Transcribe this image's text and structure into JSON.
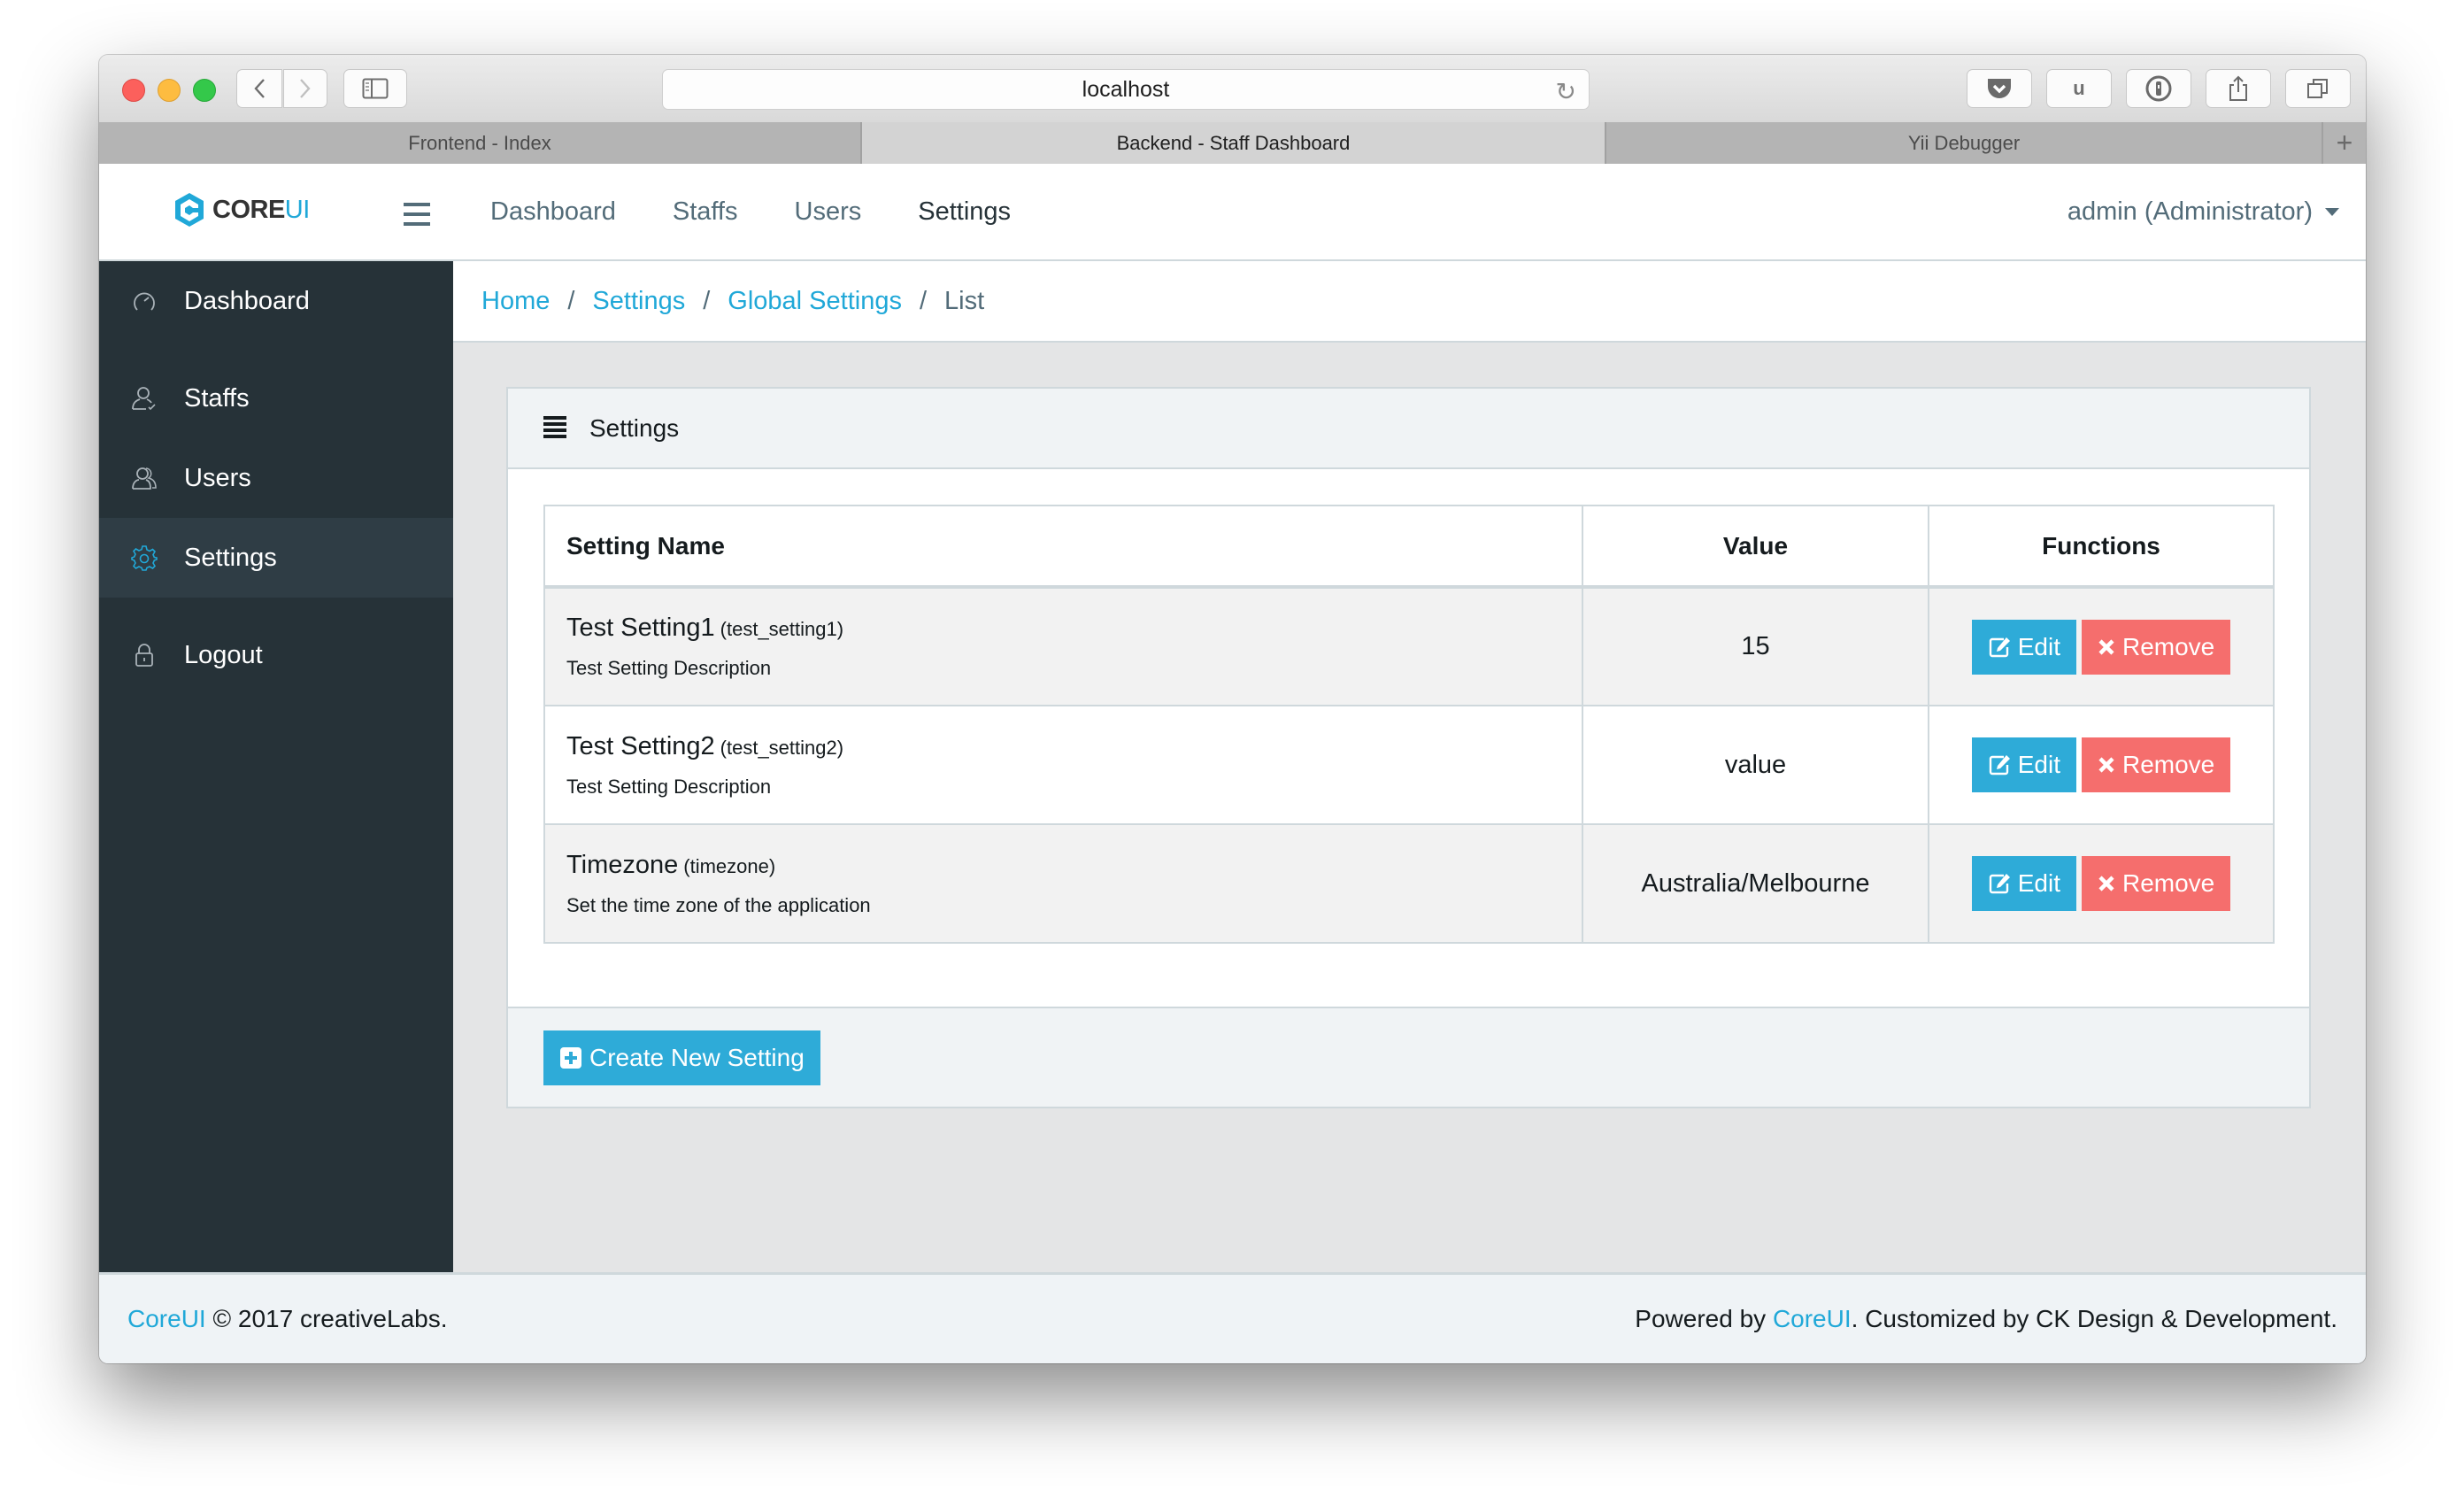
{
  "browser": {
    "address": "localhost",
    "tabs": [
      {
        "label": "Frontend - Index",
        "active": false
      },
      {
        "label": "Backend - Staff Dashboard",
        "active": true
      },
      {
        "label": "Yii Debugger",
        "active": false
      }
    ],
    "toolbar_icons": [
      "pocket-icon",
      "ublock-icon",
      "1password-icon",
      "share-icon",
      "tabs-overview-icon"
    ],
    "ublock_label": "u",
    "new_tab_label": "+"
  },
  "header": {
    "logo_core": "CORE",
    "logo_ui": "UI",
    "nav": [
      {
        "label": "Dashboard",
        "active": false
      },
      {
        "label": "Staffs",
        "active": false
      },
      {
        "label": "Users",
        "active": false
      },
      {
        "label": "Settings",
        "active": true
      }
    ],
    "user": "admin (Administrator)"
  },
  "sidebar": {
    "items": [
      {
        "label": "Dashboard",
        "icon": "speedometer-icon",
        "active": false
      },
      {
        "label": "Staffs",
        "icon": "user-follow-icon",
        "active": false
      },
      {
        "label": "Users",
        "icon": "people-icon",
        "active": false
      },
      {
        "label": "Settings",
        "icon": "gear-icon",
        "active": true
      },
      {
        "label": "Logout",
        "icon": "lock-icon",
        "active": false
      }
    ]
  },
  "breadcrumb": {
    "items": [
      "Home",
      "Settings",
      "Global Settings"
    ],
    "separator": "/",
    "current": "List"
  },
  "card": {
    "title": "Settings",
    "table": {
      "columns": [
        "Setting Name",
        "Value",
        "Functions"
      ],
      "rows": [
        {
          "name": "Test Setting1",
          "key": "(test_setting1)",
          "description": "Test Setting Description",
          "value": "15"
        },
        {
          "name": "Test Setting2",
          "key": "(test_setting2)",
          "description": "Test Setting Description",
          "value": "value"
        },
        {
          "name": "Timezone",
          "key": "(timezone)",
          "description": "Set the time zone of the application",
          "value": "Australia/Melbourne"
        }
      ],
      "edit_label": "Edit",
      "remove_label": "Remove"
    },
    "create_label": "Create New Setting"
  },
  "footer": {
    "left_link": "CoreUI",
    "left_text": " © 2017 creativeLabs.",
    "right_prefix": "Powered by ",
    "right_link": "CoreUI",
    "right_suffix": ". Customized by CK Design & Development."
  },
  "colors": {
    "primary": "#20a8d8",
    "danger": "#f86c6b",
    "sidebar_bg": "#263238",
    "sidebar_active": "#2f3d45"
  }
}
